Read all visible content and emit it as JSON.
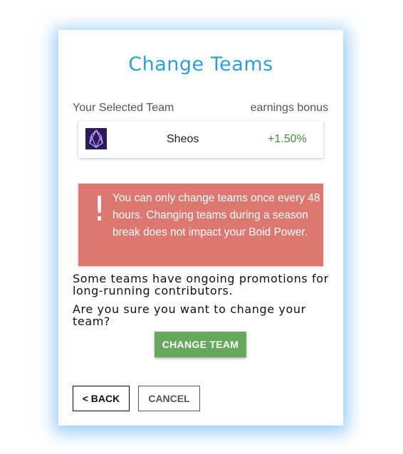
{
  "dialog": {
    "title": "Change Teams",
    "header": {
      "left": "Your Selected Team",
      "right": "earnings bonus"
    },
    "team": {
      "name": "Sheos",
      "bonus": "+1.50%",
      "logo_icon": "eos-crystal-icon",
      "logo_color": "#2b1a5c",
      "bonus_color": "#3f8f3a"
    },
    "warning": {
      "icon": "exclamation-icon",
      "text": "You can only change teams once every 48 hours. Changing teams during a season break does not impact your Boid Power.",
      "color": "#dc7870"
    },
    "info": {
      "promo": "Some teams have ongoing promotions for long-running contributors.",
      "question": "Are you sure you want to change your team?"
    },
    "buttons": {
      "change": "CHANGE TEAM",
      "back": "< BACK",
      "cancel": "CANCEL"
    },
    "colors": {
      "accent": "#2a9fe0",
      "primary_button": "#66a85c"
    }
  }
}
